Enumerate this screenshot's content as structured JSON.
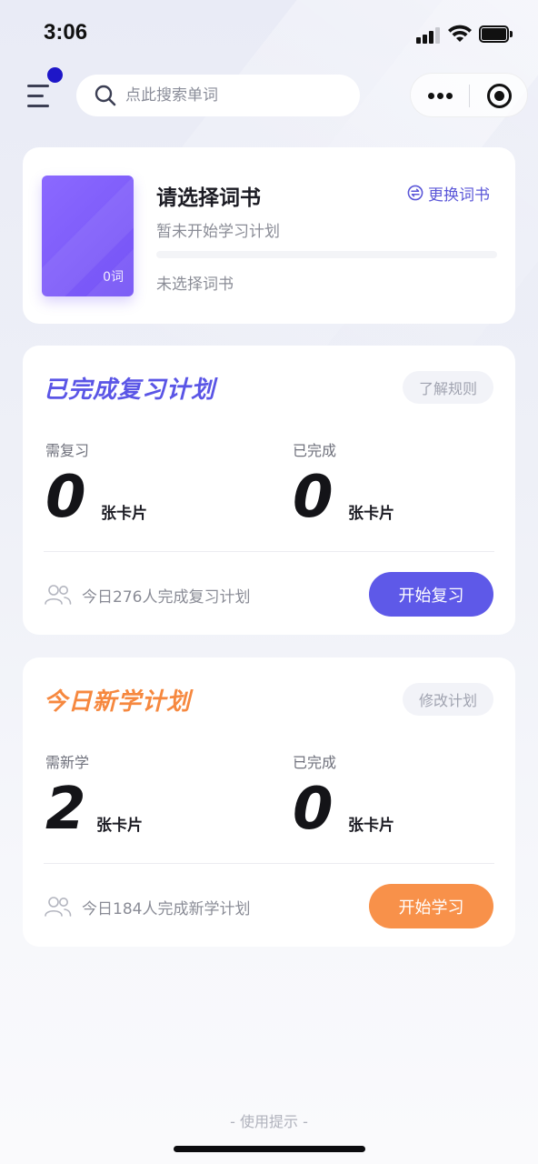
{
  "status_bar": {
    "time": "3:06"
  },
  "search": {
    "placeholder": "点此搜索单词"
  },
  "book": {
    "title": "请选择词书",
    "subtitle": "暂未开始学习计划",
    "change_label": "更换词书",
    "status": "未选择词书",
    "cover_count": "0词",
    "progress": 0
  },
  "review_plan": {
    "title": "已完成复习计划",
    "rules_button": "了解规则",
    "need_label": "需复习",
    "need_count": "0",
    "done_label": "已完成",
    "done_count": "0",
    "unit": "张卡片",
    "footer_text": "今日276人完成复习计划",
    "action_button": "开始复习"
  },
  "new_plan": {
    "title": "今日新学计划",
    "edit_button": "修改计划",
    "need_label": "需新学",
    "need_count": "2",
    "done_label": "已完成",
    "done_count": "0",
    "unit": "张卡片",
    "footer_text": "今日184人完成新学计划",
    "action_button": "开始学习"
  },
  "tips": "- 使用提示 -",
  "colors": {
    "review_accent": "#5e59e8",
    "new_accent": "#f8914a",
    "book_cover": "#7b5bf8",
    "notification_dot": "#1e16c8"
  }
}
